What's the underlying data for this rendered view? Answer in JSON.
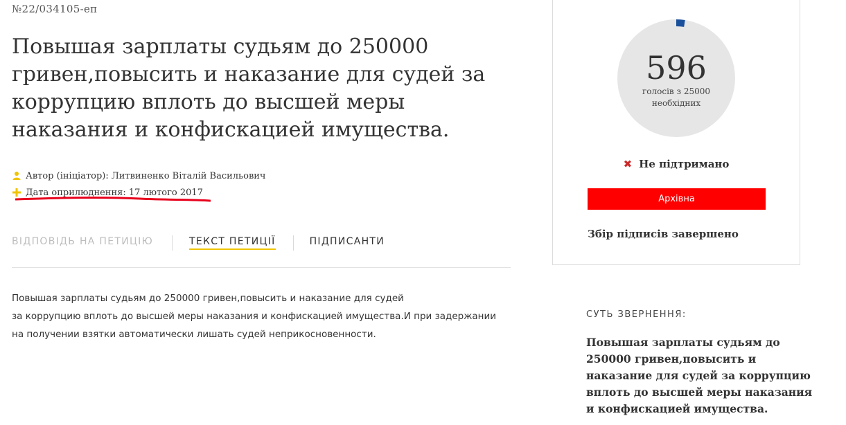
{
  "petition": {
    "number": "№22/034105-еп",
    "title": "Повышая зарплаты судьям до 250000 гривен,повысить и наказание для судей за коррупцию вплоть до высшей меры наказания и конфискацией имущества.",
    "author": "Автор (ініціатор): Литвиненко Віталій Васильович",
    "date": "Дата оприлюднення: 17 лютого 2017"
  },
  "tabs": [
    {
      "label": "ВІДПОВІДЬ НА ПЕТИЦІЮ"
    },
    {
      "label": "ТЕКСТ ПЕТИЦІЇ"
    },
    {
      "label": "ПІДПИСАНТИ"
    }
  ],
  "body": {
    "line1": "Повышая зарплаты судьям до 250000 гривен,повысить и наказание для судей",
    "line2": "за коррупцию вплоть до высшей меры наказания и конфискацией имущества.И при задержании",
    "line3": "на получении взятки автоматически лишать судей неприкосновенности."
  },
  "votes": {
    "count": "596",
    "caption_line1": "голосів з 25000",
    "caption_line2": "необхідних",
    "progress_fraction": 0.0238,
    "required": 25000
  },
  "status": {
    "label": "Не підтримано",
    "icon": "close-icon"
  },
  "archive_button": "Архівна",
  "collection_status": "Збір підписів завершено",
  "essence": {
    "heading": "СУТЬ ЗВЕРНЕННЯ:",
    "text": "Повышая зарплаты судьям до 250000 гривен,повысить и наказание для судей за коррупцию вплоть до высшей меры наказания и конфискацией имущества."
  },
  "colors": {
    "accent_yellow": "#f0c400",
    "archive_red": "#ff0000",
    "annotation_red": "#e8001c",
    "progress_blue": "#1a4f9c",
    "circle_gray": "#e6e6e6"
  }
}
